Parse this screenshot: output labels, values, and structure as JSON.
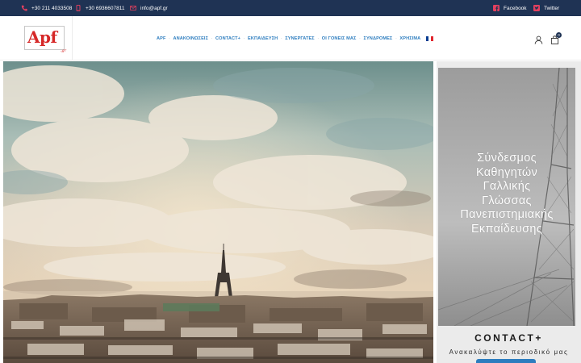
{
  "topbar": {
    "phone1": "+30 211 4033508",
    "phone2": "+30 6936607811",
    "email": "info@apf.gr",
    "social1": "Facebook",
    "social2": "Twitter",
    "icons": {
      "phone1": "phone-icon",
      "phone2": "mobile-icon",
      "email": "mail-icon",
      "social1": "facebook-icon",
      "social2": "twitter-icon"
    }
  },
  "logo": {
    "text": "Apf",
    "suffix": ".gr"
  },
  "nav": {
    "items": [
      "APF",
      "ΑΝΑΚΟΙΝΩΣΕΙΣ",
      "CONTACT+",
      "ΕΚΠΑΙΔΕΥΣΗ",
      "ΣΥΝΕΡΓΑΤΕΣ",
      "ΟΙ ΓΟΝΕΙΣ ΜΑΣ",
      "ΣΥΝΔΡΟΜΕΣ",
      "ΧΡΗΣΙΜΑ"
    ],
    "separator": "·",
    "language_flag": "french-flag-icon"
  },
  "header_icons": {
    "account": "user-icon",
    "cart": "shopping-bag-icon",
    "cart_count": "0"
  },
  "side_panel": {
    "lines": [
      "Σύνδεσμος",
      "Καθηγητών",
      "Γαλλικής",
      "Γλώσσας",
      "Πανεπιστημιακής",
      "Εκπαίδευσης"
    ],
    "contact_title": "CONTACT+",
    "contact_subtitle": "Ανακαλύψτε το περιοδικό μας"
  },
  "colors": {
    "topbar": "#1f3354",
    "accent": "#2d7dbf",
    "social": "#e4405f",
    "logo_red": "#d62828"
  }
}
